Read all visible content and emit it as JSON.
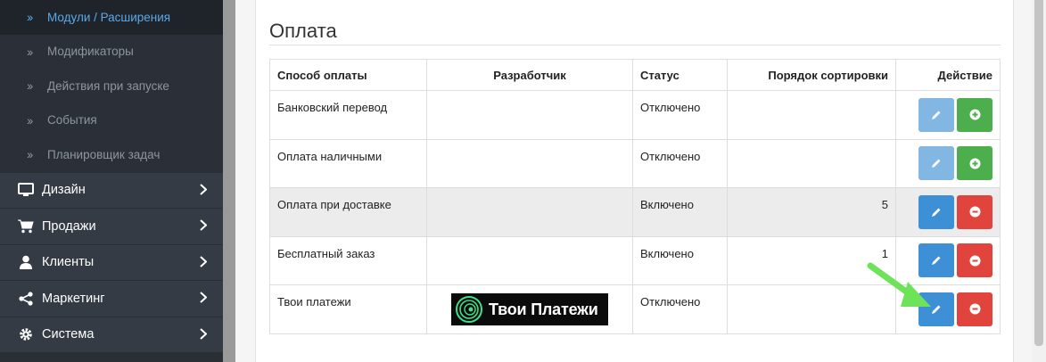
{
  "sidebar": {
    "subitems": [
      {
        "label": "Модули / Расширения",
        "active": true
      },
      {
        "label": "Модификаторы"
      },
      {
        "label": "Действия при запуске"
      },
      {
        "label": "События"
      },
      {
        "label": "Планировщик задач"
      }
    ],
    "items": [
      {
        "label": "Дизайн",
        "icon": "monitor-icon"
      },
      {
        "label": "Продажи",
        "icon": "cart-icon"
      },
      {
        "label": "Клиенты",
        "icon": "user-icon"
      },
      {
        "label": "Маркетинг",
        "icon": "share-icon"
      },
      {
        "label": "Система",
        "icon": "gear-icon"
      }
    ]
  },
  "page": {
    "title": "Оплата"
  },
  "table": {
    "headers": {
      "method": "Способ оплаты",
      "developer": "Разработчик",
      "status": "Статус",
      "sort": "Порядок сортировки",
      "action": "Действие"
    },
    "rows": [
      {
        "method": "Банковский перевод",
        "developer": "",
        "status": "Отключено",
        "sort": "",
        "installed": false
      },
      {
        "method": "Оплата наличными",
        "developer": "",
        "status": "Отключено",
        "sort": "",
        "installed": false
      },
      {
        "method": "Оплата при доставке",
        "developer": "",
        "status": "Включено",
        "sort": "5",
        "installed": true
      },
      {
        "method": "Бесплатный заказ",
        "developer": "",
        "status": "Включено",
        "sort": "1",
        "installed": true
      },
      {
        "method": "Твои платежи",
        "developer_logo": "Твои Платежи",
        "status": "Отключено",
        "sort": "",
        "installed": true
      }
    ]
  },
  "colors": {
    "sidebar_bg": "#2a2f36",
    "active_link": "#5aa9e6",
    "edit_button": "#3d8fd6",
    "install_button": "#4cae4c",
    "remove_button": "#e0443c",
    "annotation_arrow": "#6ee35a"
  }
}
